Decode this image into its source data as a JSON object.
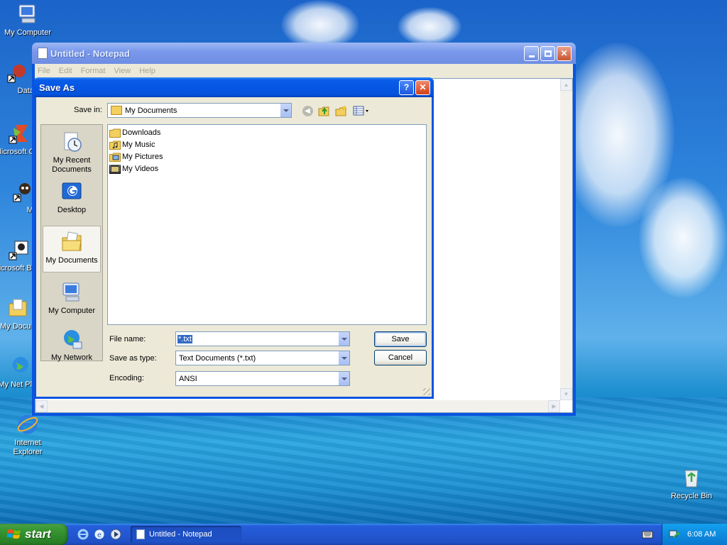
{
  "desktop": {
    "icons": [
      {
        "label": "My Computer"
      },
      {
        "label": "DataWa"
      },
      {
        "label": "Microsoft C++"
      },
      {
        "label": "Myp"
      },
      {
        "label": "Microsoft Basic"
      },
      {
        "label": "My Docu"
      },
      {
        "label": "My Net Plac"
      },
      {
        "label": "Internet Explorer"
      },
      {
        "label": "Recycle Bin"
      }
    ]
  },
  "notepad": {
    "title": "Untitled - Notepad",
    "menu": [
      "File",
      "Edit",
      "Format",
      "View",
      "Help"
    ]
  },
  "save_dialog": {
    "title": "Save As",
    "save_in_label": "Save in:",
    "save_in_value": "My Documents",
    "places": [
      {
        "label": "My Recent Documents"
      },
      {
        "label": "Desktop"
      },
      {
        "label": "My Documents"
      },
      {
        "label": "My Computer"
      },
      {
        "label": "My Network"
      }
    ],
    "files": [
      {
        "name": "Downloads",
        "icon": "folder-icon"
      },
      {
        "name": "My Music",
        "icon": "music-folder-icon"
      },
      {
        "name": "My Pictures",
        "icon": "pictures-folder-icon"
      },
      {
        "name": "My Videos",
        "icon": "videos-folder-icon"
      }
    ],
    "file_name_label": "File name:",
    "file_name_value": "*.txt",
    "save_as_type_label": "Save as type:",
    "save_as_type_value": "Text Documents (*.txt)",
    "encoding_label": "Encoding:",
    "encoding_value": "ANSI",
    "save_button": "Save",
    "cancel_button": "Cancel"
  },
  "taskbar": {
    "start_label": "start",
    "task_label": "Untitled - Notepad",
    "clock": "6:08 AM"
  },
  "colors": {
    "titlebar_active": "#0a5ee8",
    "taskbar": "#245edb",
    "start_button": "#3c9a37"
  }
}
